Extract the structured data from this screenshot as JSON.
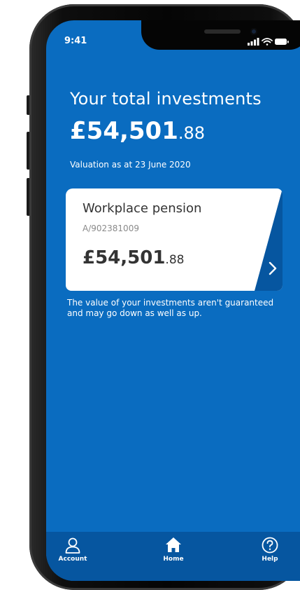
{
  "status_bar": {
    "time": "9:41",
    "icons": [
      "signal-icon",
      "wifi-icon",
      "battery-icon"
    ]
  },
  "summary": {
    "heading": "Your total investments",
    "total_major": "£54,501",
    "total_minor": ".88",
    "valuation_date": "Valuation as at 23 June 2020"
  },
  "card": {
    "title": "Workplace pension",
    "account_number": "A/902381009",
    "value_major": "£54,501",
    "value_minor": ".88",
    "chevron_icon": "chevron-right-icon"
  },
  "disclaimer": "The value of your investments aren't guaranteed and may go down as well as up.",
  "nav": {
    "items": [
      {
        "label": "Account",
        "icon": "person-icon"
      },
      {
        "label": "Home",
        "icon": "home-icon"
      },
      {
        "label": "Help",
        "icon": "help-icon"
      }
    ]
  },
  "colors": {
    "screen_background": "#0a6cc0",
    "nav_background": "#0656a0",
    "card_background": "#ffffff",
    "card_accent": "#0656a0"
  }
}
